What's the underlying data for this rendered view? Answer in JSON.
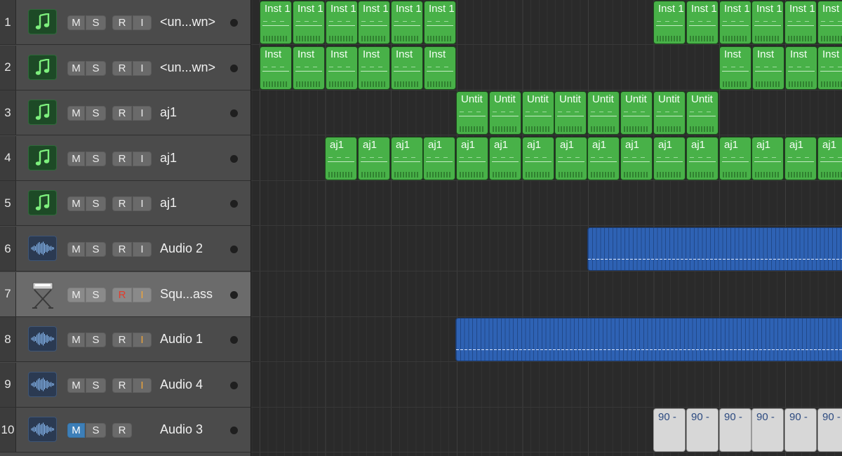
{
  "tracks": [
    {
      "number": "1",
      "name": "<un...wn>",
      "type": "midi",
      "buttons": [
        "M",
        "S",
        "R",
        "I"
      ]
    },
    {
      "number": "2",
      "name": "<un...wn>",
      "type": "midi",
      "buttons": [
        "M",
        "S",
        "R",
        "I"
      ]
    },
    {
      "number": "3",
      "name": "aj1",
      "type": "midi",
      "buttons": [
        "M",
        "S",
        "R",
        "I"
      ]
    },
    {
      "number": "4",
      "name": "aj1",
      "type": "midi",
      "buttons": [
        "M",
        "S",
        "R",
        "I"
      ]
    },
    {
      "number": "5",
      "name": "aj1",
      "type": "midi",
      "buttons": [
        "M",
        "S",
        "R",
        "I"
      ]
    },
    {
      "number": "6",
      "name": "Audio 2",
      "type": "audio",
      "buttons": [
        "M",
        "S",
        "R",
        "I"
      ]
    },
    {
      "number": "7",
      "name": "Squ...ass",
      "type": "keyboard",
      "selected": true,
      "record_armed": true,
      "input_monitor": true,
      "buttons": [
        "M",
        "S",
        "R",
        "I"
      ]
    },
    {
      "number": "8",
      "name": "Audio 1",
      "type": "audio",
      "input_monitor": true,
      "buttons": [
        "M",
        "S",
        "R",
        "I"
      ]
    },
    {
      "number": "9",
      "name": "Audio 4",
      "type": "audio",
      "input_monitor": true,
      "buttons": [
        "M",
        "S",
        "R",
        "I"
      ]
    },
    {
      "number": "10",
      "name": "Audio 3",
      "type": "audio",
      "mute_active": true,
      "buttons": [
        "M",
        "S",
        "R"
      ]
    }
  ],
  "regions": {
    "lane1": {
      "label": "Inst 1",
      "color": "green"
    },
    "lane2": {
      "label": "Inst",
      "color": "green"
    },
    "lane3": {
      "label": "Untit",
      "color": "green"
    },
    "lane4": {
      "label": "aj1",
      "color": "green"
    },
    "lane6": {
      "color": "blue"
    },
    "lane8": {
      "color": "blue"
    },
    "lane10": {
      "label": "90 -",
      "color": "gray"
    }
  },
  "colors": {
    "midi_region": "#48b148",
    "audio_region": "#2e62b4",
    "mute_active": "#3d7fb8",
    "record_armed": "#e53a2a",
    "input_monitor": "#f0a53a"
  },
  "icons": {
    "midi": "music-note-icon",
    "audio": "audio-waveform-icon",
    "keyboard": "keyboard-stand-icon"
  }
}
